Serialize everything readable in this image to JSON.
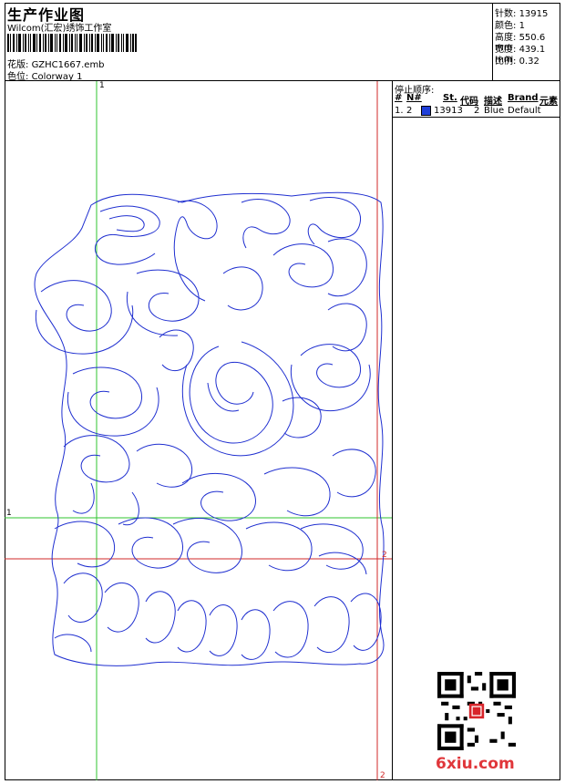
{
  "header": {
    "title": "生产作业图",
    "subtitle": "Wilcom(汇宏)绣饰工作室",
    "design_label": "花版:",
    "design_value": "GZHC1667.emb",
    "colorway_label": "色位:",
    "colorway_value": "Colorway 1"
  },
  "stats": [
    {
      "label": "针数:",
      "value": "13915"
    },
    {
      "label": "颜色:",
      "value": "1"
    },
    {
      "label": "高度:",
      "value": "550.6 mm"
    },
    {
      "label": "宽度:",
      "value": "439.1 mm"
    },
    {
      "label": "比例:",
      "value": "0.32"
    }
  ],
  "stop_sequence": {
    "title": "停止顺序:",
    "headers": [
      "#",
      "N#",
      "St.",
      "代码",
      "描述",
      "Brand",
      "元素"
    ],
    "rows": [
      {
        "index": "1.",
        "needle": "2",
        "color": "#1f3fd8",
        "stitches": "13913",
        "code": "2",
        "description": "Blue",
        "brand": "Default"
      }
    ]
  },
  "axis_markers": {
    "green_vertical_top": "1",
    "green_horizontal_left": "1",
    "red_vertical_bottom": "2",
    "red_horizontal_right": "2"
  },
  "watermark": {
    "text": "6xiu.com"
  },
  "colors": {
    "stitch": "#1f2fd0",
    "guide_green": "#2fc42f",
    "guide_red": "#d02a2a"
  }
}
